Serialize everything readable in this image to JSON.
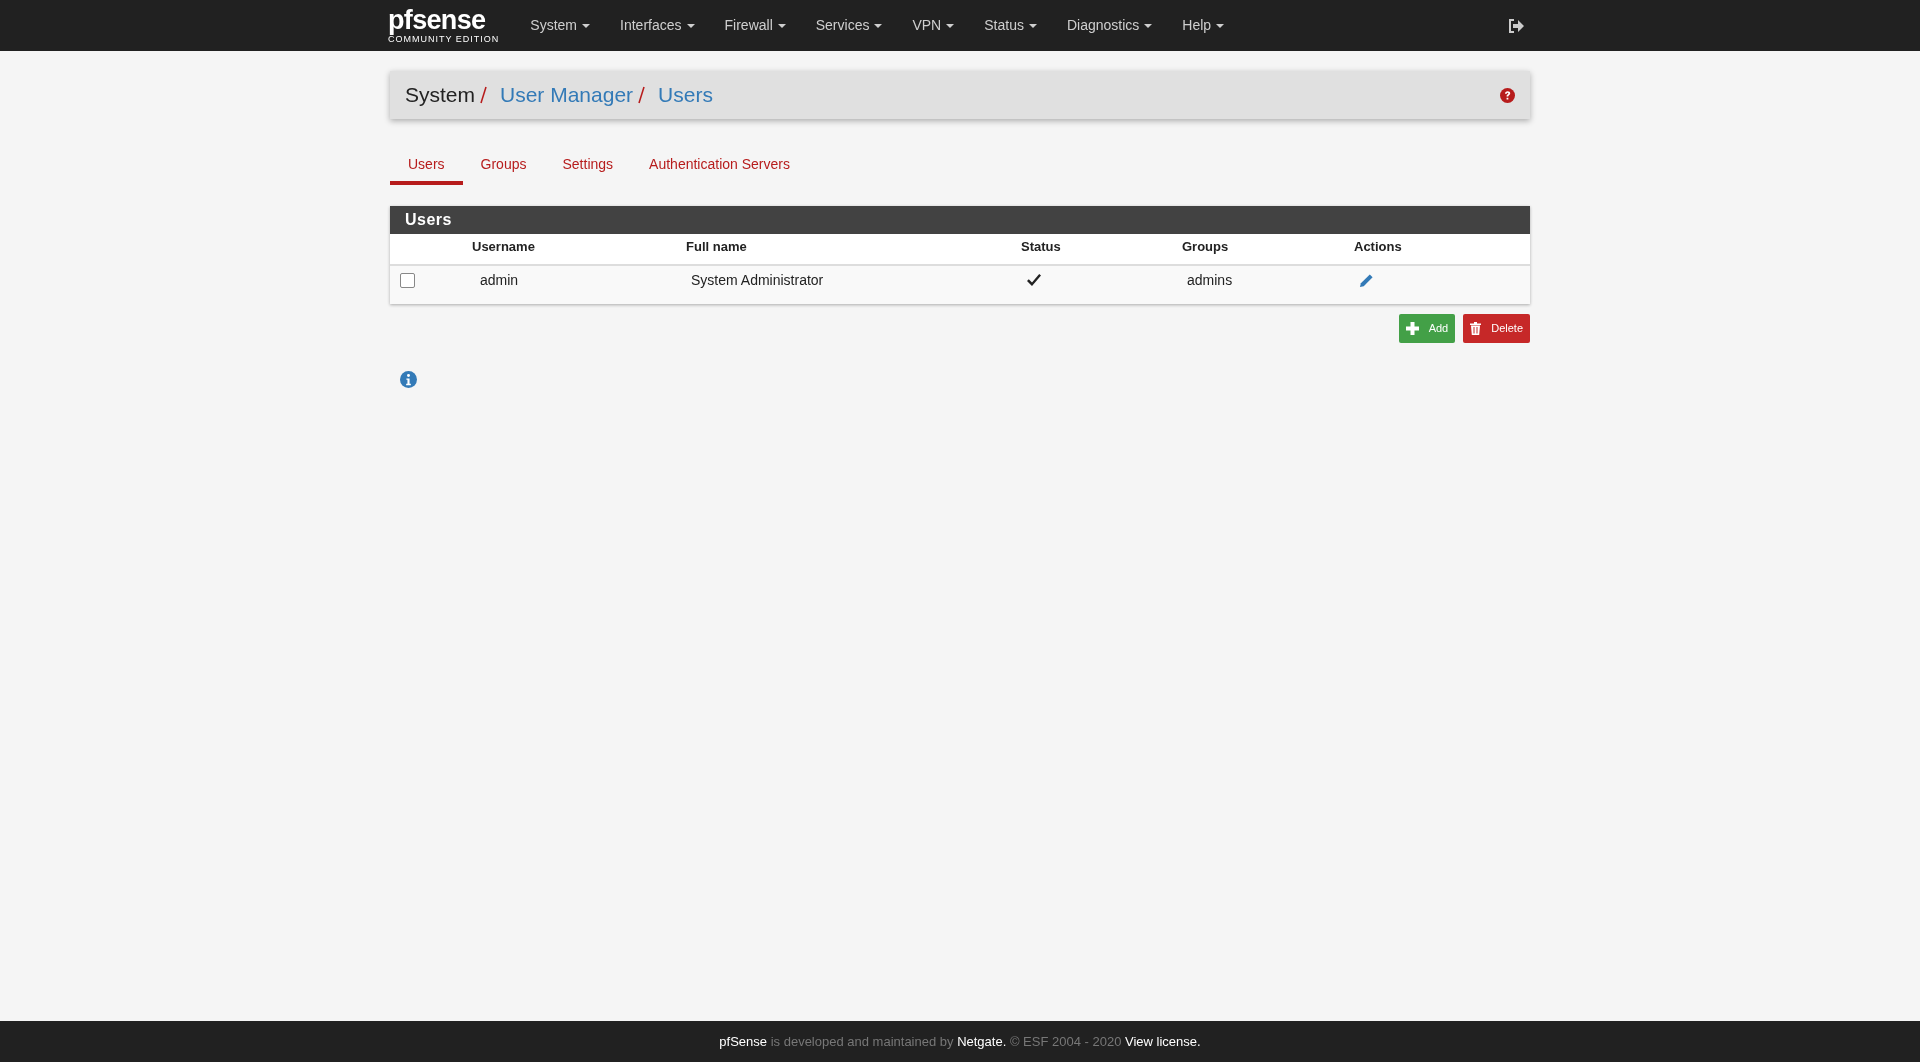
{
  "navbar": {
    "logo": "pfsense",
    "logo_subtitle": "COMMUNITY EDITION",
    "menus": [
      "System",
      "Interfaces",
      "Firewall",
      "Services",
      "VPN",
      "Status",
      "Diagnostics",
      "Help"
    ]
  },
  "breadcrumb": [
    {
      "label": "System",
      "kind": "plain"
    },
    {
      "label": "User Manager",
      "kind": "link"
    },
    {
      "label": "Users",
      "kind": "link"
    }
  ],
  "tabs": [
    {
      "label": "Users",
      "selected": true
    },
    {
      "label": "Groups",
      "selected": false
    },
    {
      "label": "Settings",
      "selected": false
    },
    {
      "label": "Authentication Servers",
      "selected": false
    }
  ],
  "panel": {
    "title": "Users",
    "columns": [
      "Username",
      "Full name",
      "Status",
      "Groups",
      "Actions"
    ],
    "rows": [
      {
        "checked": false,
        "username": "admin",
        "full_name": "System Administrator",
        "enabled": true,
        "groups": "admins"
      }
    ]
  },
  "buttons": [
    {
      "label": "Add",
      "kind": "add"
    },
    {
      "label": "Delete",
      "kind": "delete"
    }
  ],
  "footer": [
    {
      "text": "pfSense",
      "kind": "link"
    },
    {
      "text": " is developed and maintained by ",
      "kind": "plain"
    },
    {
      "text": "Netgate.",
      "kind": "link"
    },
    {
      "text": " © ESF 2004 - 2020 ",
      "kind": "plain"
    },
    {
      "text": "View license.",
      "kind": "link"
    }
  ]
}
